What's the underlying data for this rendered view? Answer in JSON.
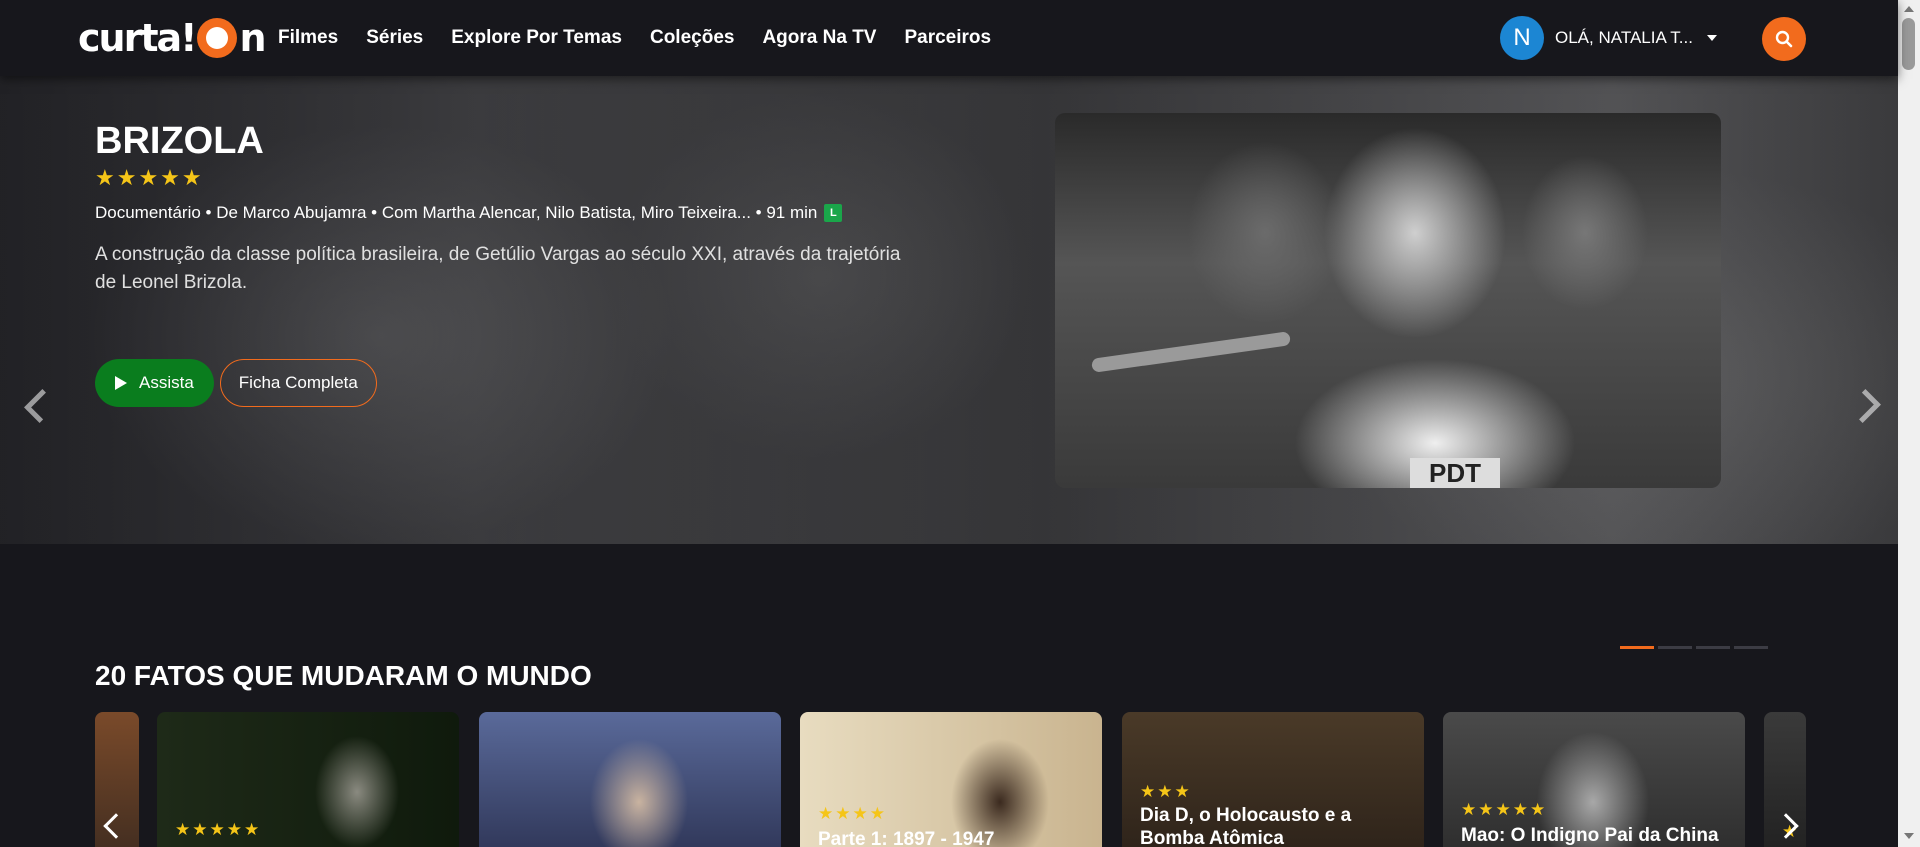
{
  "nav": {
    "logo": {
      "text": "curta!",
      "suffix": "n"
    },
    "menu": [
      "Filmes",
      "Séries",
      "Explore Por Temas",
      "Coleções",
      "Agora Na TV",
      "Parceiros"
    ],
    "user": {
      "initial": "N",
      "greeting": "OLÁ, NATALIA T..."
    },
    "search_icon": "search-icon"
  },
  "hero": {
    "title": "BRIZOLA",
    "rating_stars": 5,
    "stars": "★★★★★",
    "meta": "Documentário • De Marco Abujamra • Com Martha Alencar, Nilo Batista, Miro Teixeira... • 91 min",
    "age_rating": "L",
    "synopsis": "A construção da classe política brasileira, de Getúlio Vargas ao século XXI, através da trajetória de Leonel Brizola.",
    "watch_label": "Assista",
    "details_label": "Ficha Completa",
    "photo_sign": "PDT"
  },
  "carousel": {
    "slides": 4,
    "active": 0
  },
  "row": {
    "title": "20 FATOS QUE MUDARAM O MUNDO",
    "cards": [
      {
        "title": "",
        "stars": ""
      },
      {
        "title": "",
        "stars": "★★★★★"
      },
      {
        "title": "",
        "stars": ""
      },
      {
        "title": "Parte 1: 1897 - 1947",
        "stars": "★★★★"
      },
      {
        "title": "Dia D, o Holocausto e a Bomba Atômica",
        "stars": "★★★"
      },
      {
        "title": "Mao: O Indigno Pai da China",
        "stars": "★★★★★"
      },
      {
        "title": "",
        "stars": "★"
      }
    ]
  },
  "colors": {
    "accent": "#f26b1d",
    "watch": "#0a7d1e",
    "avatar": "#1c86d3",
    "background": "#17171c"
  }
}
